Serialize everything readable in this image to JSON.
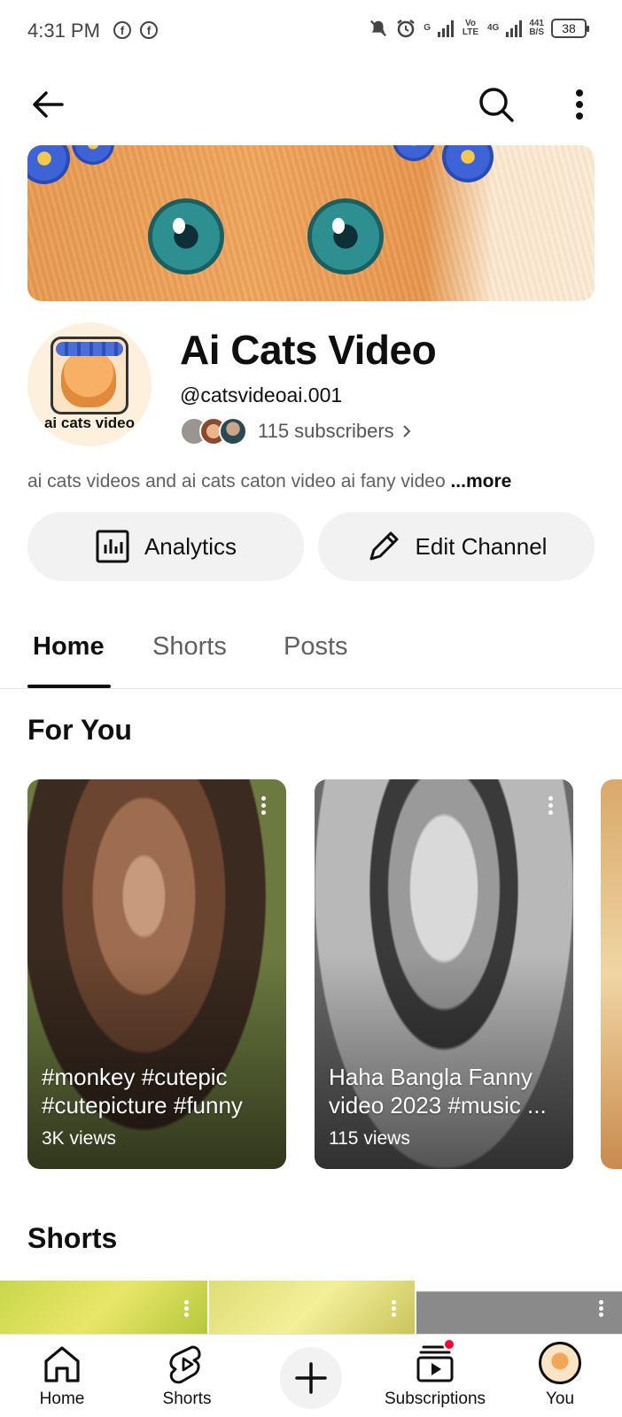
{
  "status_bar": {
    "time": "4:31 PM",
    "net_speed_top": "441",
    "net_speed_bottom": "B/S",
    "network_label_1": "G",
    "network_label_2": "Vo LTE",
    "network_label_3": "4G",
    "battery": "38"
  },
  "channel": {
    "name": "Ai Cats Video",
    "handle": "@catsvideoai.001",
    "subscribers": "115 subscribers",
    "description": "ai cats videos and ai cats caton video ai fany video",
    "more_label": "...more",
    "avatar_text": "ai cats video"
  },
  "actions": {
    "analytics_label": "Analytics",
    "edit_label": "Edit Channel"
  },
  "tabs": [
    {
      "label": "Home",
      "active": true
    },
    {
      "label": "Shorts",
      "active": false
    },
    {
      "label": "Posts",
      "active": false
    }
  ],
  "for_you": {
    "title": "For You",
    "videos": [
      {
        "title": "#monkey #cutepic #cutepicture #funny",
        "views": "3K views"
      },
      {
        "title": "Haha Bangla Fanny video 2023 #music ...",
        "views": "115 views"
      }
    ]
  },
  "shorts_section": {
    "title": "Shorts"
  },
  "bottom_nav": {
    "items": [
      {
        "label": "Home",
        "icon": "home-icon"
      },
      {
        "label": "Shorts",
        "icon": "shorts-icon"
      },
      {
        "label": "Create",
        "icon": "plus-icon"
      },
      {
        "label": "Subscriptions",
        "icon": "subscriptions-icon"
      },
      {
        "label": "You",
        "icon": "avatar-icon"
      }
    ]
  },
  "colors": {
    "accent_red": "#ff0033",
    "text_primary": "#0f0f0f",
    "text_secondary": "#606060",
    "pill_bg": "#f2f2f2"
  }
}
